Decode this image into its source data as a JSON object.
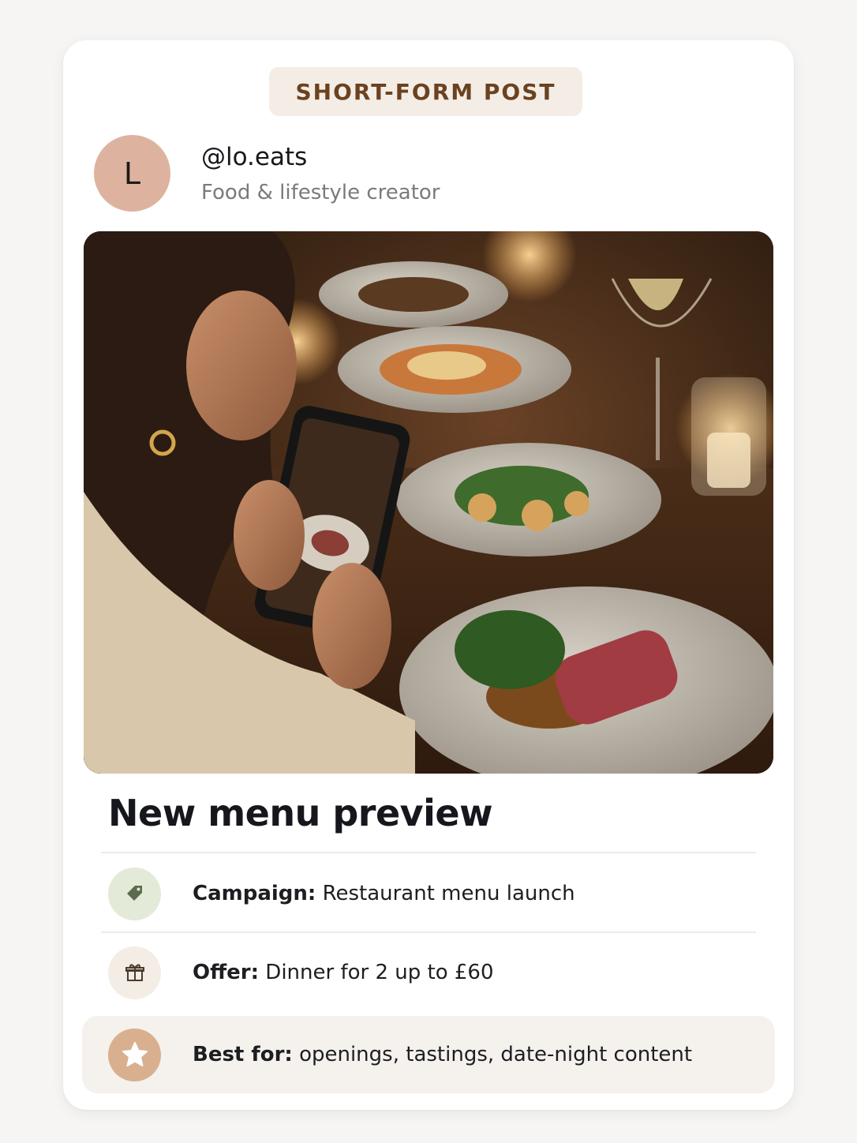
{
  "post_type_label": "SHORT-FORM POST",
  "creator": {
    "avatar_initial": "L",
    "handle": "@lo.eats",
    "role": "Food & lifestyle creator"
  },
  "hero_image": {
    "description": "photo"
  },
  "post_title": "New menu preview",
  "details": [
    {
      "key": "Campaign:",
      "value": " Restaurant menu launch",
      "icon": "tag-icon",
      "icon_bg": "#e3ead8",
      "icon_color": "#5a6b4e"
    },
    {
      "key": "Offer:",
      "value": " Dinner for 2 up to £60",
      "icon": "gift-icon",
      "icon_bg": "#f4ede6",
      "icon_color": "#4a3b30"
    },
    {
      "key": "Best for:",
      "value": " openings, tastings, date-night content",
      "icon": "star-icon",
      "icon_bg": "#d9b08f",
      "icon_color": "#ffffff"
    }
  ],
  "colors": {
    "accent_text": "#6b4220",
    "pill_bg": "#f4ede6",
    "avatar_bg": "#ddb3a0"
  }
}
